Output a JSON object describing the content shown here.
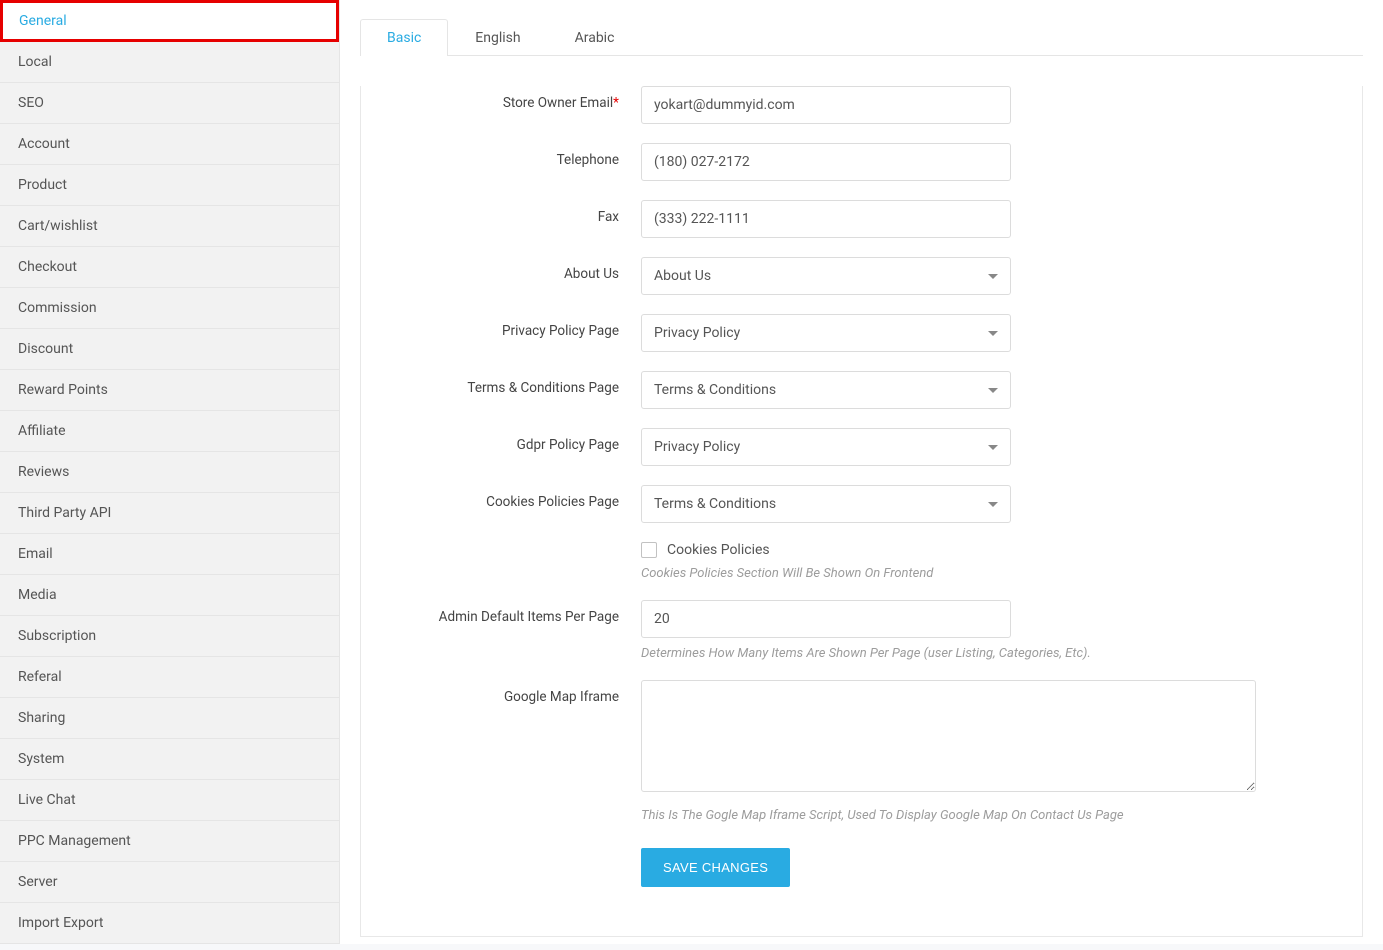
{
  "sidebar": {
    "items": [
      {
        "label": "General",
        "active": true
      },
      {
        "label": "Local"
      },
      {
        "label": "SEO"
      },
      {
        "label": "Account"
      },
      {
        "label": "Product"
      },
      {
        "label": "Cart/wishlist"
      },
      {
        "label": "Checkout"
      },
      {
        "label": "Commission"
      },
      {
        "label": "Discount"
      },
      {
        "label": "Reward Points"
      },
      {
        "label": "Affiliate"
      },
      {
        "label": "Reviews"
      },
      {
        "label": "Third Party API"
      },
      {
        "label": "Email"
      },
      {
        "label": "Media"
      },
      {
        "label": "Subscription"
      },
      {
        "label": "Referal"
      },
      {
        "label": "Sharing"
      },
      {
        "label": "System"
      },
      {
        "label": "Live Chat"
      },
      {
        "label": "PPC Management"
      },
      {
        "label": "Server"
      },
      {
        "label": "Import Export"
      }
    ]
  },
  "tabs": [
    {
      "label": "Basic",
      "active": true
    },
    {
      "label": "English"
    },
    {
      "label": "Arabic"
    }
  ],
  "form": {
    "store_owner_email": {
      "label": "Store Owner Email",
      "required": true,
      "value": "yokart@dummyid.com"
    },
    "telephone": {
      "label": "Telephone",
      "value": "(180) 027-2172"
    },
    "fax": {
      "label": "Fax",
      "value": "(333) 222-1111"
    },
    "about_us": {
      "label": "About Us",
      "value": "About Us"
    },
    "privacy_policy": {
      "label": "Privacy Policy Page",
      "value": "Privacy Policy"
    },
    "terms": {
      "label": "Terms & Conditions Page",
      "value": "Terms & Conditions"
    },
    "gdpr": {
      "label": "Gdpr Policy Page",
      "value": "Privacy Policy"
    },
    "cookies_page": {
      "label": "Cookies Policies Page",
      "value": "Terms & Conditions"
    },
    "cookies_check": {
      "label": "Cookies Policies",
      "help": "Cookies Policies Section Will Be Shown On Frontend"
    },
    "items_per_page": {
      "label": "Admin Default Items Per Page",
      "value": "20",
      "help": "Determines How Many Items Are Shown Per Page (user Listing, Categories, Etc)."
    },
    "map_iframe": {
      "label": "Google Map Iframe",
      "value": "",
      "help": "This Is The Gogle Map Iframe Script, Used To Display Google Map On Contact Us Page"
    },
    "save": "SAVE CHANGES"
  }
}
